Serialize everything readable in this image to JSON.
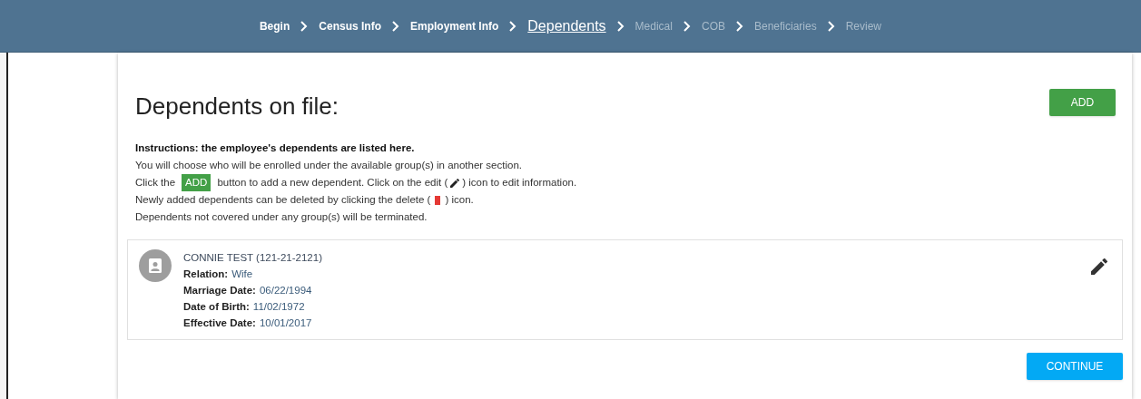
{
  "steps": [
    {
      "label": "Begin",
      "selected": false,
      "disabled": false
    },
    {
      "label": "Census Info",
      "selected": false,
      "disabled": false
    },
    {
      "label": "Employment Info",
      "selected": false,
      "disabled": false
    },
    {
      "label": "Dependents",
      "selected": true,
      "disabled": false
    },
    {
      "label": "Medical",
      "selected": false,
      "disabled": true
    },
    {
      "label": "COB",
      "selected": false,
      "disabled": true
    },
    {
      "label": "Beneficiaries",
      "selected": false,
      "disabled": true
    },
    {
      "label": "Review",
      "selected": false,
      "disabled": true
    }
  ],
  "title": "Dependents on file:",
  "add_button": "ADD",
  "instructions": {
    "heading": "Instructions: the employee's dependents are listed here.",
    "lines": [
      [
        {
          "kind": "text",
          "text": "You will choose who will be enrolled under the available group(s) in another section."
        }
      ],
      [
        {
          "kind": "text",
          "text": "Click the"
        },
        {
          "kind": "badge",
          "text": "ADD"
        },
        {
          "kind": "text",
          "text": "button to add a new dependent. Click on the edit ("
        },
        {
          "kind": "edit-icon"
        },
        {
          "kind": "text",
          "text": ") icon to edit information."
        }
      ],
      [
        {
          "kind": "text",
          "text": "Newly added dependents can be deleted by clicking the delete ("
        },
        {
          "kind": "delete-icon"
        },
        {
          "kind": "text",
          "text": ") icon."
        }
      ],
      [
        {
          "kind": "text",
          "text": "Dependents not covered under any group(s) will be terminated."
        }
      ]
    ]
  },
  "dependents": [
    {
      "name": "CONNIE TEST (121-21-2121)",
      "fields": [
        {
          "label": "Relation:",
          "value": "Wife"
        },
        {
          "label": "Marriage Date:",
          "value": "06/22/1994"
        },
        {
          "label": "Date of Birth:",
          "value": "11/02/1972"
        },
        {
          "label": "Effective Date:",
          "value": "10/01/2017"
        }
      ]
    }
  ],
  "continue_button": "CONTINUE"
}
